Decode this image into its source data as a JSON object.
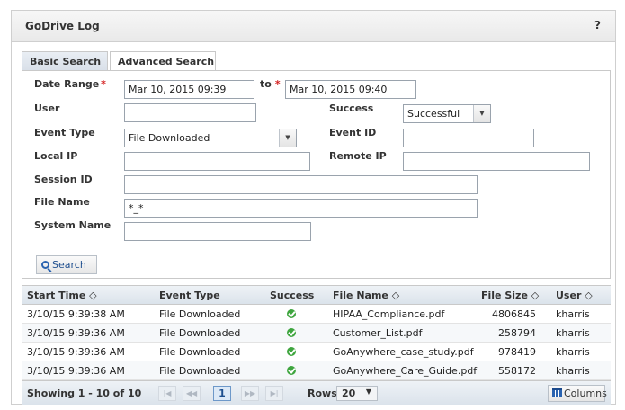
{
  "header": {
    "title": "GoDrive Log",
    "help": "?"
  },
  "tabs": [
    {
      "label": "Basic Search",
      "active": false
    },
    {
      "label": "Advanced Search",
      "active": true
    }
  ],
  "form": {
    "date_range_label": "Date Range",
    "required_mark": "*",
    "date_from": "Mar 10, 2015 09:39",
    "to_label": "to",
    "date_to": "Mar 10, 2015 09:40",
    "user_label": "User",
    "user_value": "",
    "success_label": "Success",
    "success_value": "Successful",
    "event_type_label": "Event Type",
    "event_type_value": "File Downloaded",
    "event_id_label": "Event ID",
    "event_id_value": "",
    "local_ip_label": "Local IP",
    "local_ip_value": "",
    "remote_ip_label": "Remote IP",
    "remote_ip_value": "",
    "session_id_label": "Session ID",
    "session_id_value": "",
    "file_name_label": "File Name",
    "file_name_value": "*_*",
    "system_name_label": "System Name",
    "system_name_value": "",
    "search_button": "Search"
  },
  "grid": {
    "columns": {
      "start_time": "Start Time ◇",
      "event_type": "Event Type",
      "success": "Success",
      "file_name": "File Name ◇",
      "file_size": "File Size ◇",
      "user": "User ◇"
    },
    "rows": [
      {
        "start_time": "3/10/15 9:39:38 AM",
        "event_type": "File Downloaded",
        "file_name": "HIPAA_Compliance.pdf",
        "file_size": "4806845",
        "user": "kharris"
      },
      {
        "start_time": "3/10/15 9:39:36 AM",
        "event_type": "File Downloaded",
        "file_name": "Customer_List.pdf",
        "file_size": "258794",
        "user": "kharris"
      },
      {
        "start_time": "3/10/15 9:39:36 AM",
        "event_type": "File Downloaded",
        "file_name": "GoAnywhere_case_study.pdf",
        "file_size": "978419",
        "user": "kharris"
      },
      {
        "start_time": "3/10/15 9:39:36 AM",
        "event_type": "File Downloaded",
        "file_name": "GoAnywhere_Care_Guide.pdf",
        "file_size": "558172",
        "user": "kharris"
      }
    ],
    "footer": {
      "showing": "Showing 1 - 10 of 10",
      "first": "|◀",
      "prev": "◀◀",
      "page": "1",
      "next": "▶▶",
      "last": "▶|",
      "rows_label": "Rows",
      "rows_value": "20",
      "columns_button": "Columns"
    }
  },
  "colors": {
    "success_check": "#3ea53e",
    "accent": "#2a63b0",
    "required": "#d42020"
  },
  "icons": {
    "search": "magnifier-icon",
    "columns": "columns-icon",
    "success": "check-circle-icon"
  }
}
